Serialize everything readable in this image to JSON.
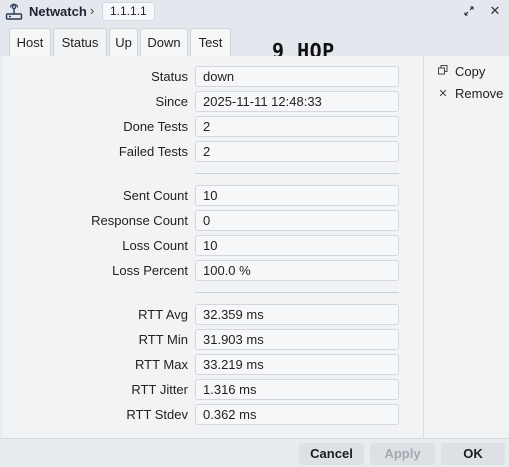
{
  "window": {
    "title": "Netwatch",
    "breadcrumb_separator": "›",
    "breadcrumb_item": "1.1.1.1",
    "restore_icon": "restore-icon",
    "close_icon": "close-icon"
  },
  "tabs": [
    {
      "label": "Host",
      "active": false
    },
    {
      "label": "Status",
      "active": true
    },
    {
      "label": "Up",
      "active": false
    },
    {
      "label": "Down",
      "active": false
    },
    {
      "label": "Test",
      "active": false
    }
  ],
  "overlay_label": "9 HOP",
  "status_fields": [
    {
      "label": "Status",
      "value": "down"
    },
    {
      "label": "Since",
      "value": "2025-11-11 12:48:33"
    },
    {
      "label": "Done Tests",
      "value": "2"
    },
    {
      "label": "Failed Tests",
      "value": "2"
    }
  ],
  "count_fields": [
    {
      "label": "Sent Count",
      "value": "10"
    },
    {
      "label": "Response Count",
      "value": "0"
    },
    {
      "label": "Loss Count",
      "value": "10"
    },
    {
      "label": "Loss Percent",
      "value": "100.0 %"
    }
  ],
  "rtt_fields": [
    {
      "label": "RTT Avg",
      "value": "32.359 ms"
    },
    {
      "label": "RTT Min",
      "value": "31.903 ms"
    },
    {
      "label": "RTT Max",
      "value": "33.219 ms"
    },
    {
      "label": "RTT Jitter",
      "value": "1.316 ms"
    },
    {
      "label": "RTT Stdev",
      "value": "0.362 ms"
    }
  ],
  "side_actions": {
    "copy": {
      "label": "Copy",
      "icon": "copy-icon"
    },
    "remove": {
      "label": "Remove",
      "icon": "remove-icon"
    }
  },
  "footer": {
    "cancel": "Cancel",
    "apply": "Apply",
    "apply_enabled": false,
    "ok": "OK"
  }
}
